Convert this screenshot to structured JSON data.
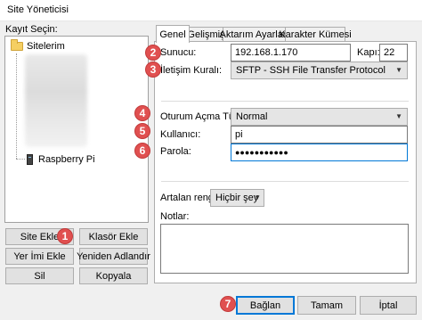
{
  "window": {
    "title": "Site Yöneticisi"
  },
  "left": {
    "label": "Kayıt Seçin:",
    "tree": {
      "root": "Sitelerim",
      "items": [
        "Raspberry Pi"
      ]
    },
    "buttons": {
      "new_site": "Site Ekle",
      "new_folder": "Klasör Ekle",
      "new_bookmark": "Yer İmi Ekle",
      "rename": "Yeniden Adlandır",
      "delete": "Sil",
      "duplicate": "Kopyala"
    }
  },
  "tabs": [
    "Genel",
    "Gelişmiş",
    "Aktarım Ayarları",
    "Karakter Kümesi"
  ],
  "general": {
    "host_label": "Sunucu:",
    "host_value": "192.168.1.170",
    "port_label": "Kapı:",
    "port_value": "22",
    "protocol_label": "İletişim Kuralı:",
    "protocol_value": "SFTP - SSH File Transfer Protocol",
    "logon_type_label": "Oturum Açma Türü:",
    "logon_type_value": "Normal",
    "user_label": "Kullanıcı:",
    "user_value": "pi",
    "password_label": "Parola:",
    "password_value": "●●●●●●●●●●●",
    "bg_color_label": "Artalan rengi:",
    "bg_color_value": "Hiçbir şey",
    "notes_label": "Notlar:"
  },
  "footer": {
    "connect": "Bağlan",
    "ok": "Tamam",
    "cancel": "İptal"
  },
  "badges": [
    "1",
    "2",
    "3",
    "4",
    "5",
    "6",
    "7"
  ],
  "colors": {
    "badge": "#e05050",
    "focus": "#0078d7",
    "folder": "#f5cf62"
  }
}
